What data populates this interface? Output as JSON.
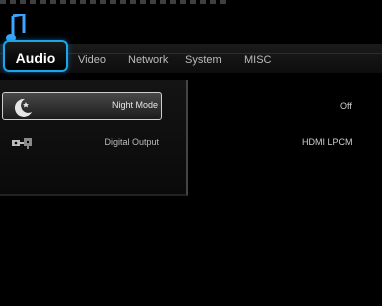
{
  "window": {
    "title": ""
  },
  "tabs": [
    {
      "label": "Audio"
    },
    {
      "label": "Video"
    },
    {
      "label": "Network"
    },
    {
      "label": "System"
    },
    {
      "label": "MISC"
    }
  ],
  "settings": [
    {
      "label": "Night Mode",
      "value": "Off",
      "icon": "night-mode-moon-icon"
    },
    {
      "label": "Digital Output",
      "value": "HDMI LPCM",
      "icon": "digital-output-connector-icon"
    }
  ],
  "colors": {
    "accent": "#1da6e6",
    "background": "#000000",
    "tab_inactive": "#bcbcbc"
  },
  "icons": {
    "header": "music-note-icon"
  }
}
